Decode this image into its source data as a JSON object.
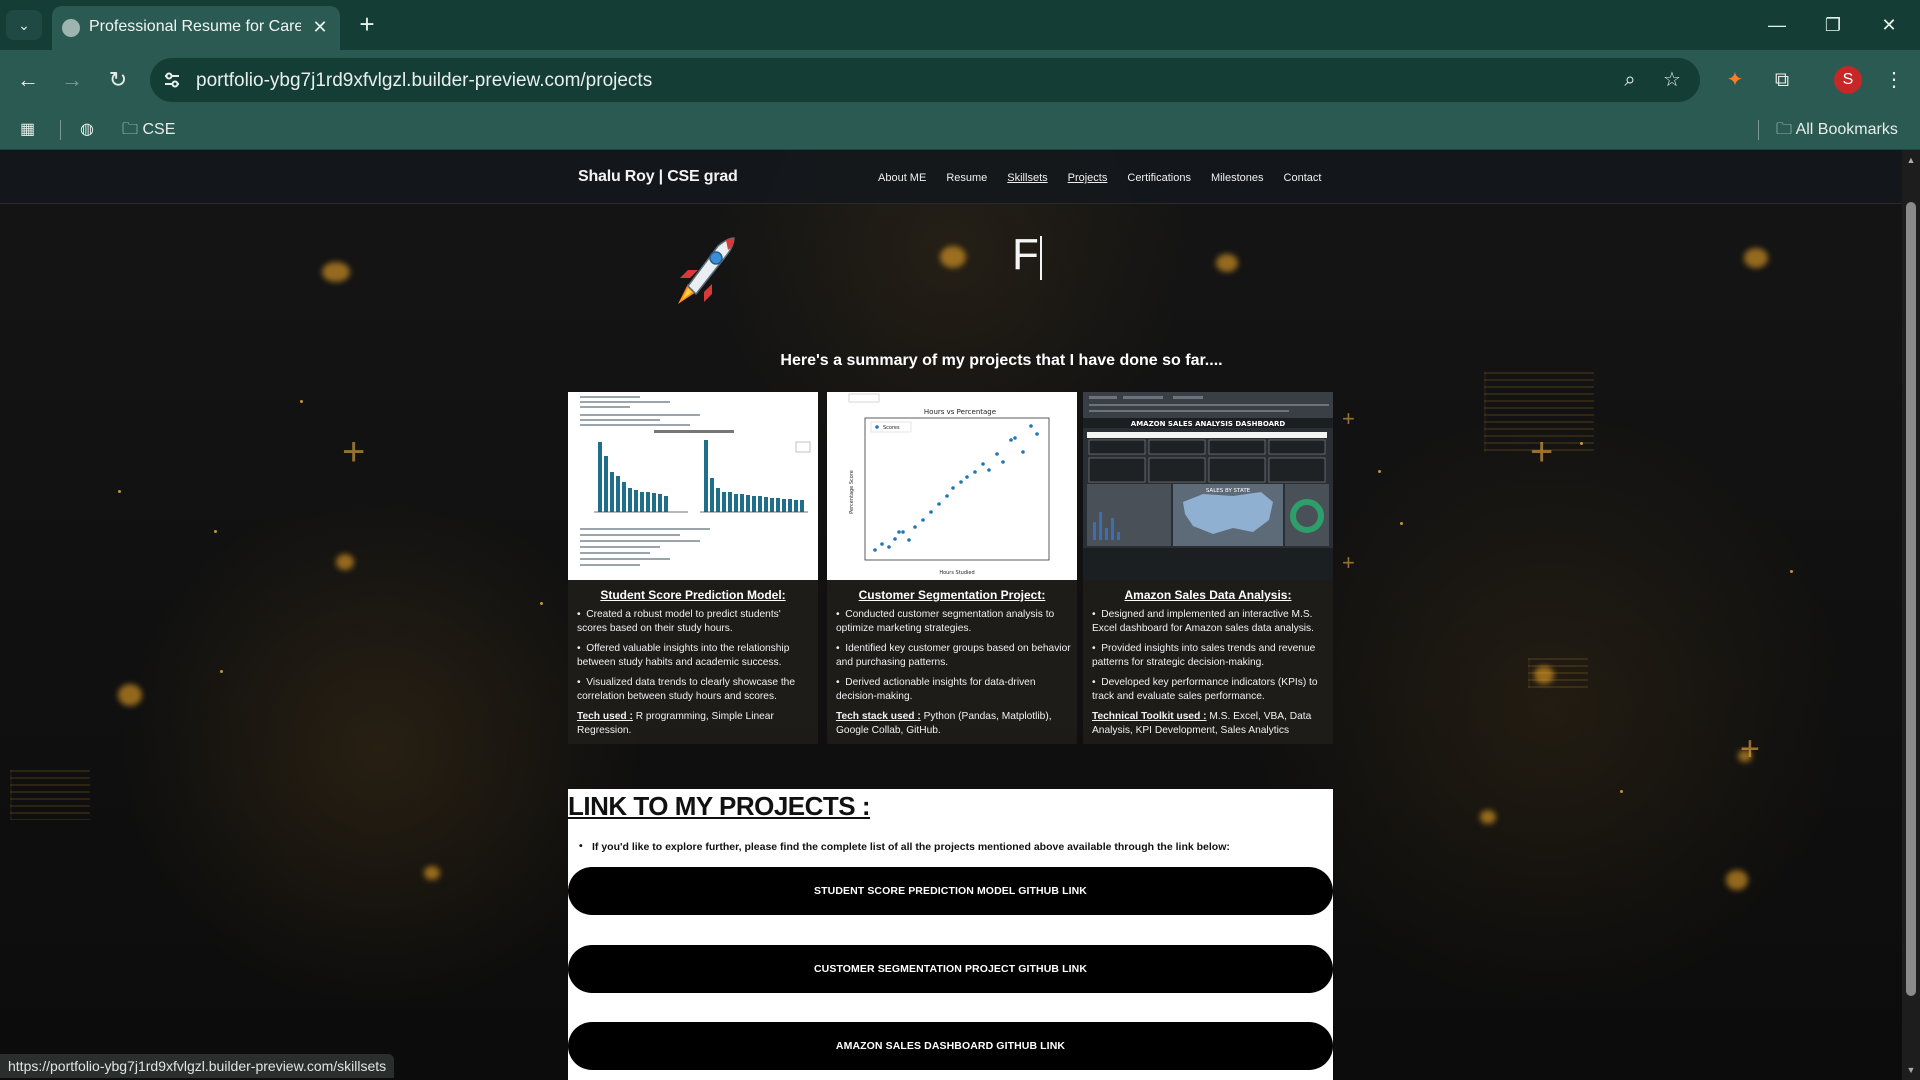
{
  "browser": {
    "tab_title": "Professional Resume for Career",
    "url": "portfolio-ybg7j1rd9xfvlgzl.builder-preview.com/projects",
    "bookmark_folder": "CSE",
    "all_bookmarks": "All Bookmarks",
    "profile_initial": "S",
    "status_url": "https://portfolio-ybg7j1rd9xfvlgzl.builder-preview.com/skillsets"
  },
  "site": {
    "brand": "Shalu Roy | CSE grad",
    "nav": [
      "About ME",
      "Resume",
      "Skillsets",
      "Projects",
      "Certifications",
      "Milestones",
      "Contact"
    ],
    "typed_text": "F",
    "summary": "Here's a summary of my projects that I have done so far...."
  },
  "projects": [
    {
      "title": "Student Score Prediction Model:",
      "bullets": [
        "Created a robust model to predict students' scores based on their study hours.",
        "Offered valuable insights into the relationship between study habits and academic success.",
        "Visualized data trends to clearly showcase the correlation between study hours and scores."
      ],
      "tech_label": "Tech used :",
      "tech": " R programming, Simple Linear Regression."
    },
    {
      "title": "Customer Segmentation Project:",
      "bullets": [
        "Conducted customer segmentation analysis to optimize marketing strategies.",
        "Identified key customer groups based on behavior and purchasing patterns.",
        "Derived actionable insights for data-driven decision-making."
      ],
      "tech_label": "Tech stack used :",
      "tech": " Python (Pandas, Matplotlib), Google Collab, GitHub."
    },
    {
      "title": "Amazon Sales Data Analysis:",
      "bullets": [
        "Designed and implemented an interactive M.S. Excel dashboard for Amazon sales data analysis.",
        "Provided insights into sales trends and revenue patterns for strategic decision-making.",
        "Developed key performance indicators (KPIs) to track and evaluate sales performance."
      ],
      "tech_label": "Technical Toolkit used :",
      "tech": " M.S. Excel, VBA, Data Analysis, KPI Development, Sales Analytics"
    }
  ],
  "thumbs": {
    "scatter_title": "Hours vs Percentage",
    "scatter_legend": "Scores",
    "scatter_xlabel": "Hours Studied",
    "scatter_ylabel": "Percentage Score",
    "dashboard_title": "AMAZON SALES ANALYSIS DASHBOARD",
    "dashboard_map": "SALES BY STATE"
  },
  "links_section": {
    "title": "LINK TO MY PROJECTS :",
    "intro": "If you'd like to explore further, please find the complete list of all the projects mentioned above available through the link below:",
    "buttons": [
      "STUDENT SCORE PREDICTION MODEL GITHUB LINK",
      "CUSTOMER SEGMENTATION PROJECT GITHUB LINK",
      "AMAZON SALES DASHBOARD GITHUB LINK"
    ]
  },
  "colors": {
    "chrome": "#2a5a52",
    "tabbar": "#143d36",
    "accent_glow": "#ffb028",
    "profile": "#c62828"
  }
}
